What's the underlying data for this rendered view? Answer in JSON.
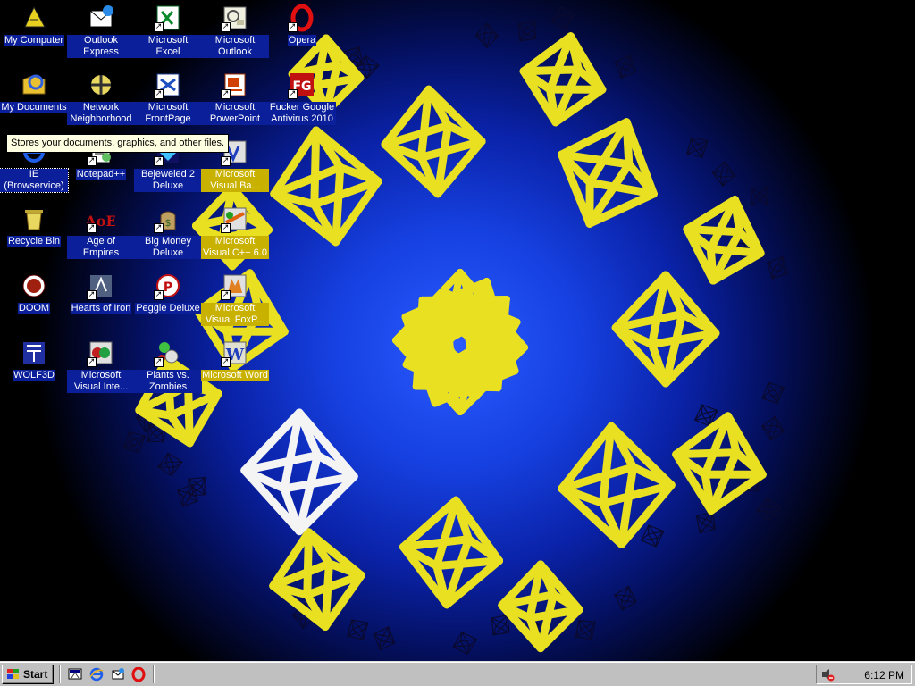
{
  "desktop": {
    "icons": [
      {
        "label": "My Computer",
        "icon": "my-computer-icon",
        "col": 0,
        "row": 0,
        "shortcut": false,
        "style": "solid"
      },
      {
        "label": "Outlook Express",
        "icon": "outlook-express-icon",
        "col": 1,
        "row": 0,
        "shortcut": false,
        "style": "solid"
      },
      {
        "label": "Microsoft Excel",
        "icon": "excel-icon",
        "col": 2,
        "row": 0,
        "shortcut": true,
        "style": "solid"
      },
      {
        "label": "Microsoft Outlook",
        "icon": "outlook-icon",
        "col": 3,
        "row": 0,
        "shortcut": true,
        "style": "solid"
      },
      {
        "label": "Opera",
        "icon": "opera-icon",
        "col": 4,
        "row": 0,
        "shortcut": true,
        "style": "solid"
      },
      {
        "label": "My Documents",
        "icon": "my-documents-icon",
        "col": 0,
        "row": 1,
        "shortcut": false,
        "style": "solid"
      },
      {
        "label": "Network Neighborhood",
        "icon": "network-neighborhood-icon",
        "col": 1,
        "row": 1,
        "shortcut": false,
        "style": "solid"
      },
      {
        "label": "Microsoft FrontPage",
        "icon": "frontpage-icon",
        "col": 2,
        "row": 1,
        "shortcut": true,
        "style": "solid"
      },
      {
        "label": "Microsoft PowerPoint",
        "icon": "powerpoint-icon",
        "col": 3,
        "row": 1,
        "shortcut": true,
        "style": "solid"
      },
      {
        "label": "Fucker Google Antivirus 2010",
        "icon": "antivirus-icon",
        "col": 4,
        "row": 1,
        "shortcut": true,
        "style": "solid"
      },
      {
        "label": "IE (Browservice)",
        "icon": "internet-explorer-icon",
        "col": 0,
        "row": 2,
        "shortcut": false,
        "style": "focus"
      },
      {
        "label": "Notepad++",
        "icon": "notepad-plus-plus-icon",
        "col": 1,
        "row": 2,
        "shortcut": true,
        "style": "solid"
      },
      {
        "label": "Bejeweled 2 Deluxe",
        "icon": "bejeweled-icon",
        "col": 2,
        "row": 2,
        "shortcut": true,
        "style": "solid"
      },
      {
        "label": "Microsoft Visual Ba...",
        "icon": "visual-basic-icon",
        "col": 3,
        "row": 2,
        "shortcut": true,
        "style": "sel"
      },
      {
        "label": "Recycle Bin",
        "icon": "recycle-bin-icon",
        "col": 0,
        "row": 3,
        "shortcut": false,
        "style": "solid"
      },
      {
        "label": "Age of Empires",
        "icon": "age-of-empires-icon",
        "col": 1,
        "row": 3,
        "shortcut": true,
        "style": "solid"
      },
      {
        "label": "Big Money Deluxe",
        "icon": "big-money-icon",
        "col": 2,
        "row": 3,
        "shortcut": true,
        "style": "solid"
      },
      {
        "label": "Microsoft Visual C++ 6.0",
        "icon": "visual-cpp-icon",
        "col": 3,
        "row": 3,
        "shortcut": true,
        "style": "sel"
      },
      {
        "label": "DOOM",
        "icon": "doom-icon",
        "col": 0,
        "row": 4,
        "shortcut": false,
        "style": "solid"
      },
      {
        "label": "Hearts of Iron",
        "icon": "hearts-of-iron-icon",
        "col": 1,
        "row": 4,
        "shortcut": true,
        "style": "solid"
      },
      {
        "label": "Peggle Deluxe",
        "icon": "peggle-icon",
        "col": 2,
        "row": 4,
        "shortcut": true,
        "style": "solid"
      },
      {
        "label": "Microsoft Visual FoxP...",
        "icon": "visual-foxpro-icon",
        "col": 3,
        "row": 4,
        "shortcut": true,
        "style": "sel"
      },
      {
        "label": "WOLF3D",
        "icon": "wolf3d-icon",
        "col": 0,
        "row": 5,
        "shortcut": false,
        "style": "solid"
      },
      {
        "label": "Microsoft Visual Inte...",
        "icon": "visual-interdev-icon",
        "col": 1,
        "row": 5,
        "shortcut": true,
        "style": "solid"
      },
      {
        "label": "Plants vs. Zombies",
        "icon": "plants-vs-zombies-icon",
        "col": 2,
        "row": 5,
        "shortcut": true,
        "style": "solid"
      },
      {
        "label": "Microsoft Word",
        "icon": "word-icon",
        "col": 3,
        "row": 5,
        "shortcut": true,
        "style": "sel"
      }
    ],
    "tooltip": "Stores your documents, graphics, and other files."
  },
  "taskbar": {
    "start_label": "Start",
    "quick_launch": [
      "show-desktop-icon",
      "internet-explorer-icon",
      "outlook-express-icon",
      "opera-icon"
    ],
    "tray_icon": "volume-icon",
    "clock": "6:12 PM"
  },
  "colors": {
    "accent_blue": "#1640e0",
    "octahedron_yellow": "#e8e020",
    "selection_yellow": "#c9b100",
    "taskbar_gray": "#c0c0c0"
  }
}
